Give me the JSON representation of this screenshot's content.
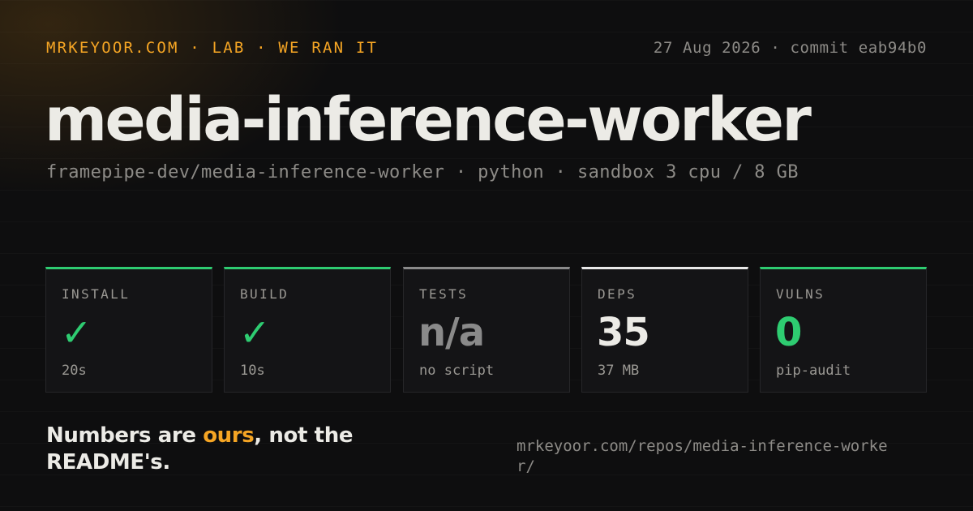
{
  "header": {
    "brand": "MRKEYOOR.COM · LAB · WE RAN IT",
    "meta": "27 Aug 2026 · commit eab94b0"
  },
  "repo": {
    "name": "media-inference-worker",
    "subtitle": "framepipe-dev/media-inference-worker · python · sandbox 3 cpu / 8 GB"
  },
  "stats": [
    {
      "label": "INSTALL",
      "value": "✓",
      "note": "20s",
      "accent": "#2ecc71"
    },
    {
      "label": "BUILD",
      "value": "✓",
      "note": "10s",
      "accent": "#2ecc71"
    },
    {
      "label": "TESTS",
      "value": "n/a",
      "note": "no script",
      "accent": "#8a8a8a"
    },
    {
      "label": "DEPS",
      "value": "35",
      "note": "37 MB",
      "accent": "#e8e8e8"
    },
    {
      "label": "VULNS",
      "value": "0",
      "note": "pip-audit",
      "accent": "#2ecc71"
    }
  ],
  "footer": {
    "tagline_before": "Numbers are ",
    "tagline_accent": "ours",
    "tagline_after": ", not the README's.",
    "url": "mrkeyoor.com/repos/media-inference-worker/"
  },
  "colors": {
    "brand_accent": "#f5a524",
    "success": "#2ecc71",
    "background": "#0e0e0f",
    "text": "#ecebe6",
    "muted": "#8d8b87"
  }
}
